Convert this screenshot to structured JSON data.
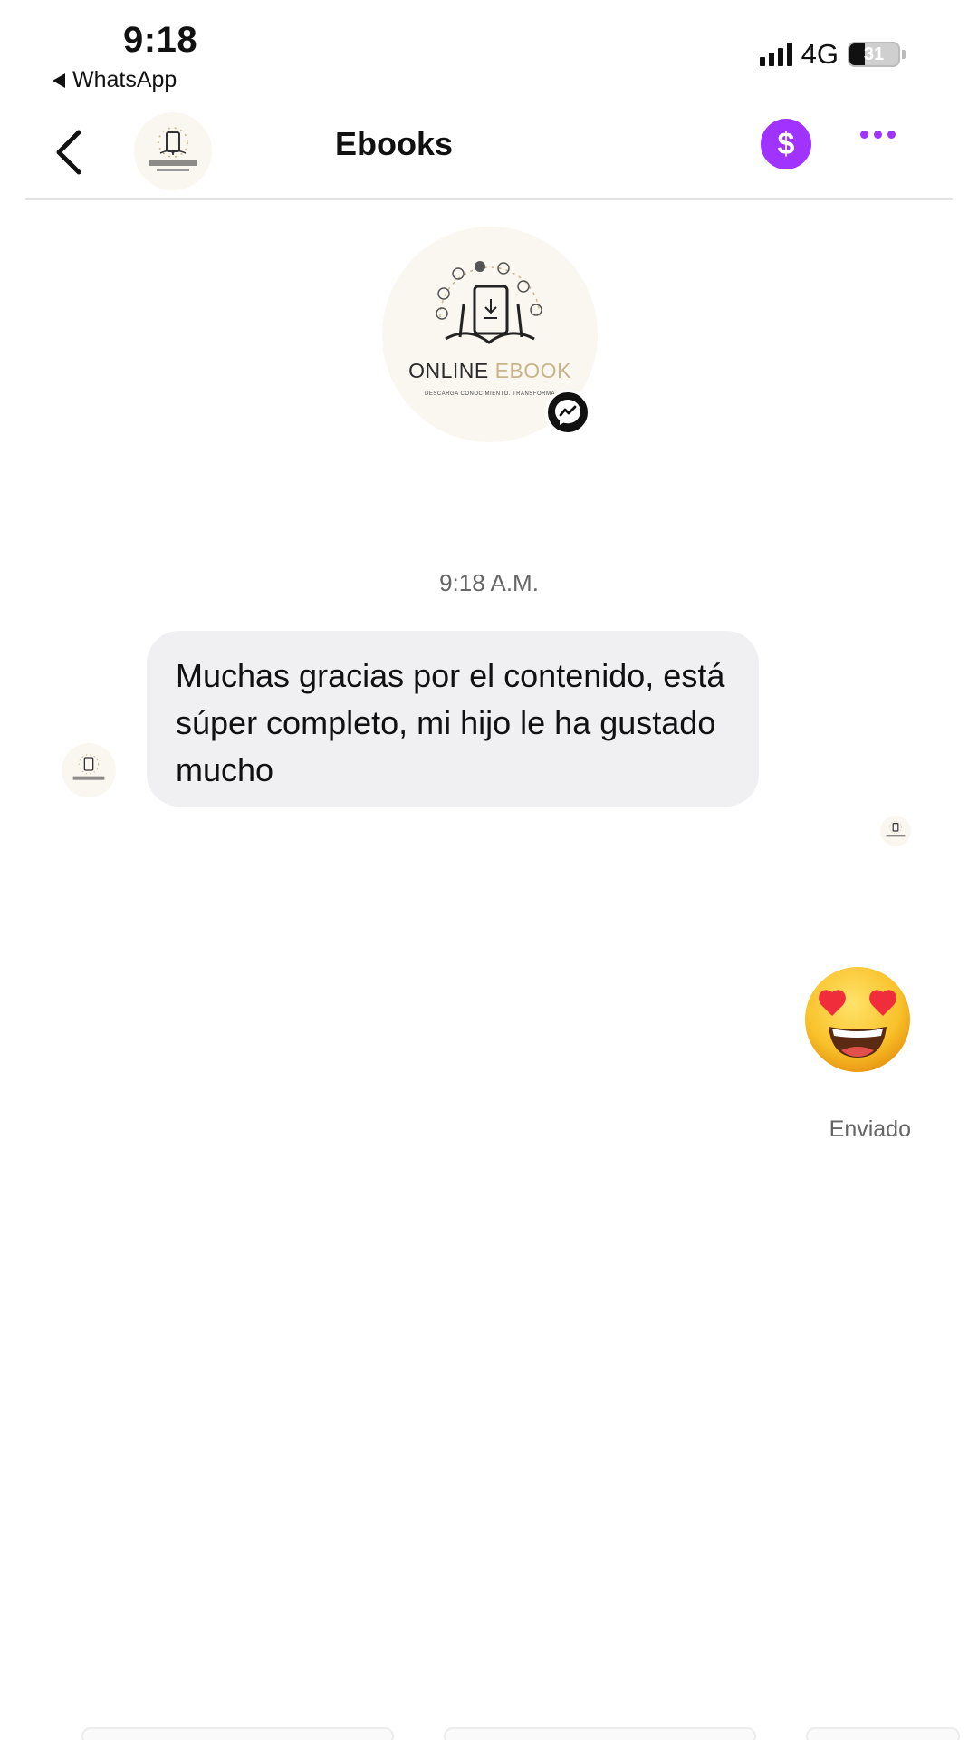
{
  "status_bar": {
    "time": "9:18",
    "back_app": "WhatsApp",
    "network": "4G",
    "battery": "31",
    "battery_level": 0.31
  },
  "header": {
    "title": "Ebooks",
    "pay_icon": "dollar-icon",
    "pay_symbol": "$",
    "more_icon": "more-horizontal-icon",
    "accent_color": "#a033ff"
  },
  "profile": {
    "logo_word1": "ONLINE",
    "logo_word2": "EBOOK",
    "logo_tagline": "DESCARGA CONOCIMIENTO. TRANSFORMA",
    "badge_icon": "messenger-icon"
  },
  "conversation": {
    "timestamp": "9:18 A.M.",
    "incoming_message": "Muchas gracias por el contenido, está súper completo, mi hijo le ha gustado mucho",
    "outgoing_emoji": "smiling-face-with-heart-eyes",
    "sent_status": "Enviado"
  }
}
